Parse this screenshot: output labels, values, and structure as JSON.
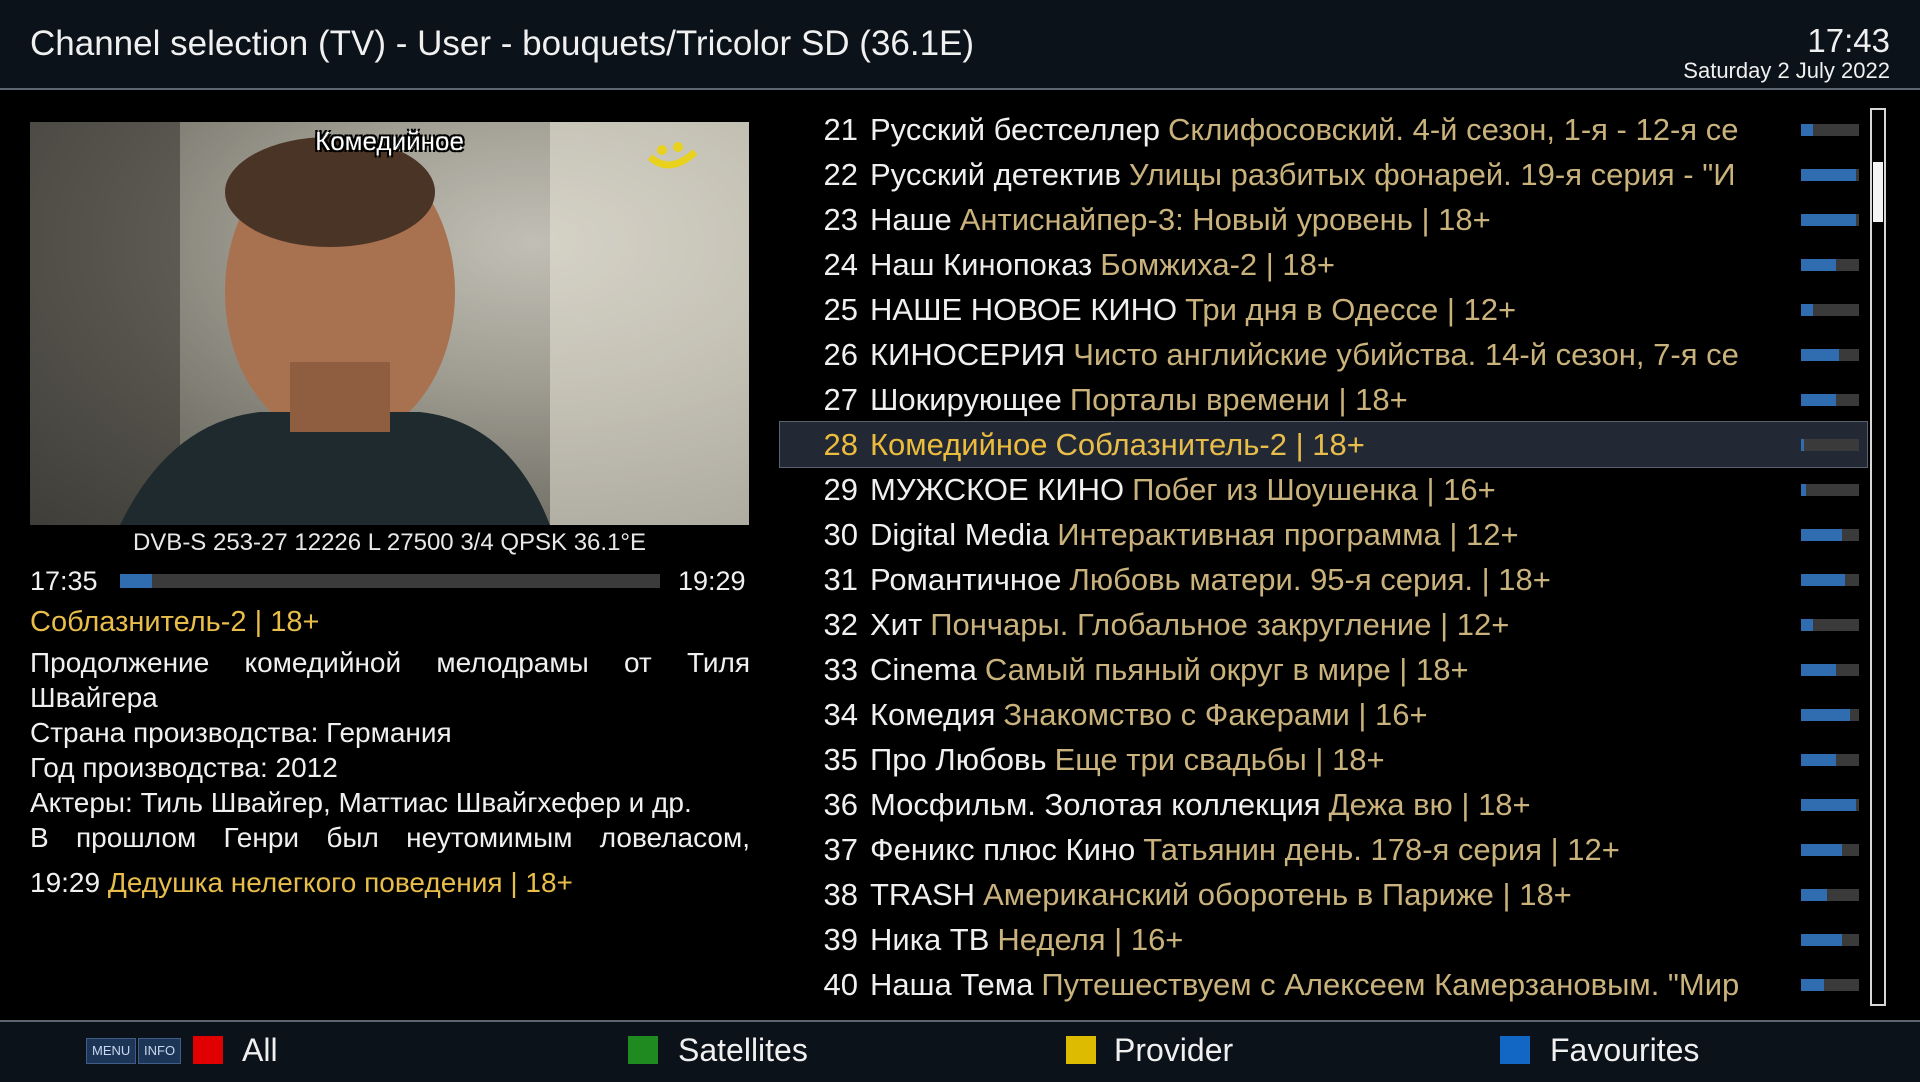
{
  "header": {
    "title": "Channel selection (TV) - User - bouquets/Tricolor SD (36.1E)",
    "clock": "17:43",
    "date": "Saturday  2 July 2022"
  },
  "preview": {
    "channel_name": "Комедийное",
    "signal_info": "DVB-S 253-27 12226 L 27500 3/4 QPSK 36.1°E",
    "start_time": "17:35",
    "end_time": "19:29",
    "progress_fraction": 0.06
  },
  "event": {
    "title": "Соблазнитель-2 | 18+",
    "description_lines": [
      "Продолжение комедийной мелодрамы от Тиля",
      "Швайгера",
      "Страна производства: Германия",
      "Год производства: 2012",
      "Актеры: Тиль Швайгер, Маттиас Швайгхефер и др.",
      "В прошлом Генри был неутомимым ловеласом,"
    ],
    "next_time": "19:29",
    "next_title": "Дедушка нелегкого поведения | 18+"
  },
  "channels": [
    {
      "num": "21",
      "name": "Русский бестселлер",
      "event": "Склифосовский. 4-й сезон, 1-я - 12-я се",
      "progress": 0.2
    },
    {
      "num": "22",
      "name": "Русский детектив",
      "event": "Улицы разбитых фонарей. 19-я серия - \"И",
      "progress": 0.95
    },
    {
      "num": "23",
      "name": "Наше",
      "event": "Антиснайпер-3: Новый уровень | 18+",
      "progress": 0.95
    },
    {
      "num": "24",
      "name": "Наш Кинопоказ",
      "event": "Бомжиха-2 | 18+",
      "progress": 0.6
    },
    {
      "num": "25",
      "name": "НАШЕ НОВОЕ КИНО",
      "event": "Три дня в Одессе | 12+",
      "progress": 0.2
    },
    {
      "num": "26",
      "name": "КИНОСЕРИЯ",
      "event": "Чисто английские убийства. 14-й сезон, 7-я се",
      "progress": 0.65
    },
    {
      "num": "27",
      "name": "Шокирующее",
      "event": "Порталы времени | 18+",
      "progress": 0.6
    },
    {
      "num": "28",
      "name": "Комедийное",
      "event": "Соблазнитель-2 | 18+",
      "progress": 0.06,
      "selected": true
    },
    {
      "num": "29",
      "name": "МУЖСКОЕ КИНО",
      "event": "Побег из Шоушенка | 16+",
      "progress": 0.08
    },
    {
      "num": "30",
      "name": "Digital Media",
      "event": "Интерактивная программа | 12+",
      "progress": 0.7
    },
    {
      "num": "31",
      "name": "Романтичное",
      "event": "Любовь матери. 95-я серия. | 18+",
      "progress": 0.75
    },
    {
      "num": "32",
      "name": "Хит",
      "event": "Пончары. Глобальное закругление | 12+",
      "progress": 0.2
    },
    {
      "num": "33",
      "name": "Cinema",
      "event": "Самый пьяный округ в мире | 18+",
      "progress": 0.6
    },
    {
      "num": "34",
      "name": "Комедия",
      "event": "Знакомство с Факерами | 16+",
      "progress": 0.85
    },
    {
      "num": "35",
      "name": "Про Любовь",
      "event": "Еще три свадьбы | 18+",
      "progress": 0.6
    },
    {
      "num": "36",
      "name": "Мосфильм. Золотая коллекция",
      "event": "Дежа вю | 18+",
      "progress": 0.95
    },
    {
      "num": "37",
      "name": "Феникс плюс Кино",
      "event": "Татьянин день. 178-я серия | 12+",
      "progress": 0.7
    },
    {
      "num": "38",
      "name": "TRASH",
      "event": "Американский оборотень в Париже | 18+",
      "progress": 0.45
    },
    {
      "num": "39",
      "name": "Ника ТВ",
      "event": "Неделя | 16+",
      "progress": 0.7
    },
    {
      "num": "40",
      "name": "Наша Тема",
      "event": "Путешествуем с Алексеем Камерзановым. \"Мир",
      "progress": 0.4
    }
  ],
  "footer": {
    "menu_label": "MENU",
    "info_label": "INFO",
    "keys": [
      {
        "color": "#e00000",
        "label": "All"
      },
      {
        "color": "#1f8a1f",
        "label": "Satellites"
      },
      {
        "color": "#ddbb00",
        "label": "Provider"
      },
      {
        "color": "#1266c4",
        "label": "Favourites"
      }
    ]
  }
}
